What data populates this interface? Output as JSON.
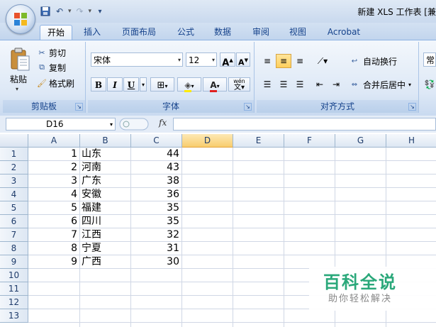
{
  "window": {
    "title": "新建 XLS 工作表 [兼"
  },
  "ribbon_tabs": [
    {
      "label": "开始",
      "active": true
    },
    {
      "label": "插入",
      "active": false
    },
    {
      "label": "页面布局",
      "active": false
    },
    {
      "label": "公式",
      "active": false
    },
    {
      "label": "数据",
      "active": false
    },
    {
      "label": "审阅",
      "active": false
    },
    {
      "label": "视图",
      "active": false
    },
    {
      "label": "Acrobat",
      "active": false
    }
  ],
  "clipboard": {
    "paste": "粘贴",
    "cut": "剪切",
    "copy": "复制",
    "format_painter": "格式刷",
    "group_label": "剪贴板"
  },
  "font": {
    "name": "宋体",
    "size": "12",
    "grow": "A",
    "shrink": "A",
    "bold": "B",
    "italic": "I",
    "underline": "U",
    "font_color_glyph": "A",
    "phonetic": "wén",
    "group_label": "字体"
  },
  "alignment": {
    "wrap_text": "自动换行",
    "merge_center": "合并后居中",
    "group_label": "对齐方式"
  },
  "number": {
    "format_partial": "常"
  },
  "formula_bar": {
    "name_box": "D16",
    "fx": "fx",
    "formula": ""
  },
  "sheet": {
    "columns": [
      "A",
      "B",
      "C",
      "D",
      "E",
      "F",
      "G",
      "H"
    ],
    "selected_column": "D",
    "row_numbers": [
      "1",
      "2",
      "3",
      "4",
      "5",
      "6",
      "7",
      "8",
      "9",
      "10",
      "11",
      "12",
      "13"
    ],
    "rows": [
      {
        "a": "1",
        "b": "山东",
        "c": "44"
      },
      {
        "a": "2",
        "b": "河南",
        "c": "43"
      },
      {
        "a": "3",
        "b": "广东",
        "c": "38"
      },
      {
        "a": "4",
        "b": "安徽",
        "c": "36"
      },
      {
        "a": "5",
        "b": "福建",
        "c": "35"
      },
      {
        "a": "6",
        "b": "四川",
        "c": "35"
      },
      {
        "a": "7",
        "b": "江西",
        "c": "32"
      },
      {
        "a": "8",
        "b": "宁夏",
        "c": "31"
      },
      {
        "a": "9",
        "b": "广西",
        "c": "30"
      }
    ]
  },
  "watermark": {
    "title": "百科全说",
    "subtitle": "助你轻松解决"
  },
  "colors": {
    "accent": "#15428b",
    "highlight": "#ffcf5c",
    "watermark": "#2aa87a"
  }
}
